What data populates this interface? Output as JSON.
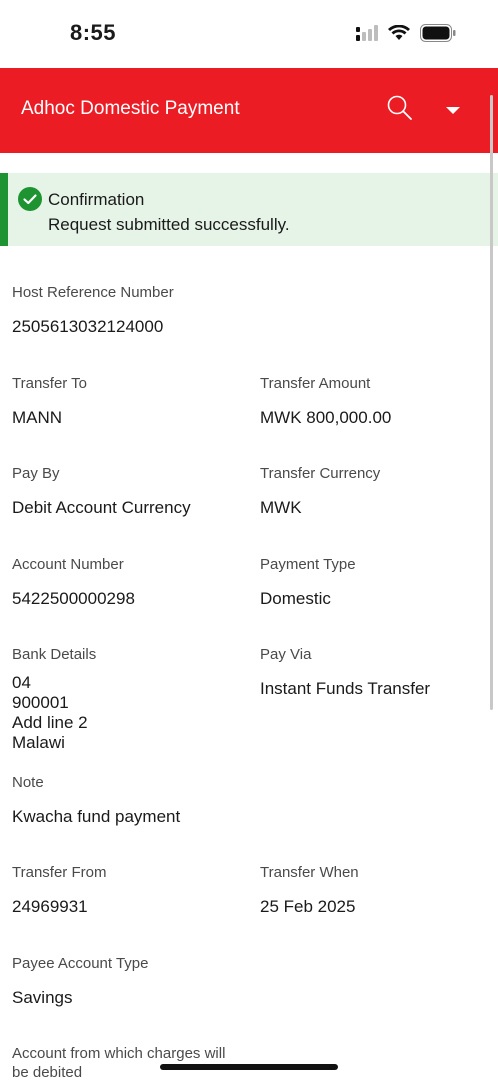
{
  "status_bar": {
    "time": "8:55"
  },
  "header": {
    "title": "Adhoc Domestic Payment",
    "search_icon": "search-icon",
    "menu_icon": "caret-down-icon"
  },
  "confirmation": {
    "title": "Confirmation",
    "message": "Request submitted successfully.",
    "accent_color": "#1d9431"
  },
  "details": {
    "host_reference": {
      "label": "Host Reference Number",
      "value": "2505613032124000"
    },
    "transfer_to": {
      "label": "Transfer To",
      "value": "MANN"
    },
    "transfer_amount": {
      "label": "Transfer Amount",
      "value": "MWK 800,000.00"
    },
    "pay_by": {
      "label": "Pay By",
      "value": "Debit Account Currency"
    },
    "transfer_currency": {
      "label": "Transfer Currency",
      "value": "MWK"
    },
    "account_number": {
      "label": "Account Number",
      "value": "5422500000298"
    },
    "payment_type": {
      "label": "Payment Type",
      "value": "Domestic"
    },
    "bank_details": {
      "label": "Bank Details",
      "lines": [
        "04",
        "900001",
        "Add line 2",
        "Malawi"
      ]
    },
    "pay_via": {
      "label": "Pay Via",
      "value": "Instant Funds Transfer"
    },
    "note": {
      "label": "Note",
      "value": "Kwacha fund payment"
    },
    "transfer_from": {
      "label": "Transfer From",
      "value": "24969931"
    },
    "transfer_when": {
      "label": "Transfer When",
      "value": "25 Feb 2025"
    },
    "payee_account_type": {
      "label": "Payee Account Type",
      "value": "Savings"
    },
    "charges_account": {
      "label_line1": "Account from which charges will",
      "label_line2": "be debited"
    }
  },
  "colors": {
    "brand": "#ec1c24",
    "banner_bg": "#e6f3e7"
  }
}
